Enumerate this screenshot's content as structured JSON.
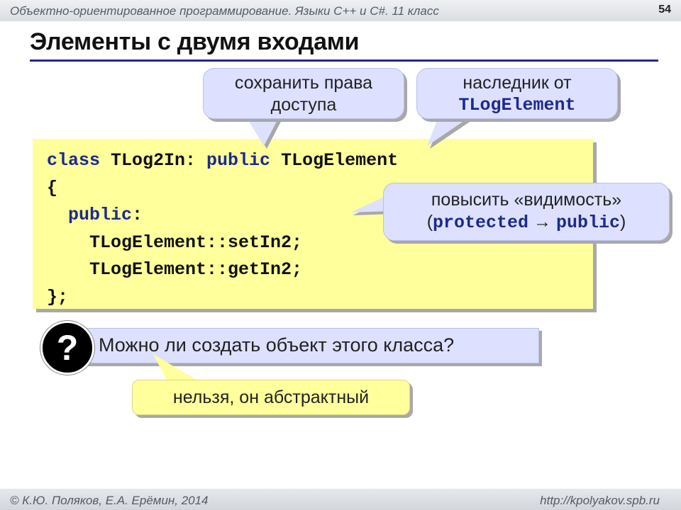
{
  "header": {
    "course_title": "Объектно-ориентированное программирование. Языки C++ и C#. 11 класс",
    "page_number": "54"
  },
  "slide": {
    "title": "Элементы с двумя входами"
  },
  "code": {
    "line1_kw1": "class",
    "line1_mid": " TLog2In: ",
    "line1_kw2": "public",
    "line1_end": " TLogElement",
    "line2": "{",
    "line3_kw": "public",
    "line3_end": ":",
    "line4": "TLogElement::setIn2;",
    "line5": "TLogElement::getIn2;",
    "line6": "};"
  },
  "callouts": {
    "access": {
      "line1": "сохранить права",
      "line2": "доступа"
    },
    "heir": {
      "line1": "наследник от",
      "code": "TLogElement"
    },
    "visibility": {
      "line1": "повысить «видимость»",
      "open": "(",
      "from": "protected",
      "arrow": "→",
      "to": "public",
      "close": ")"
    }
  },
  "question": {
    "mark": "?",
    "text": "Можно ли создать объект этого класса?"
  },
  "answer": {
    "text": "нельзя, он абстрактный"
  },
  "footer": {
    "authors": "© К.Ю. Поляков, Е.А. Ерёмин, 2014",
    "site": "http://kpolyakov.spb.ru"
  },
  "colors": {
    "code_background": "#ffff9c",
    "callout_background": "#dde1ff",
    "keyword": "#1d2a8e",
    "title_rule": "#1f2d8c"
  }
}
